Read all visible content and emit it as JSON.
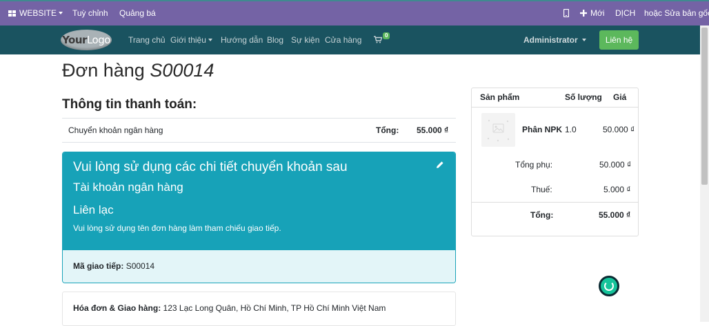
{
  "topbar": {
    "website_label": "WEBSITE",
    "customize_label": "Tuỳ chỉnh",
    "promote_label": "Quảng bá",
    "new_label": "Mới",
    "translate_label": "DỊCH",
    "edit_original_label": "hoặc Sửa bản gốc"
  },
  "navbar": {
    "logo_your": "Your",
    "logo_logo": "Logo",
    "items": [
      {
        "label": "Trang chủ"
      },
      {
        "label": "Giới thiệu"
      },
      {
        "label": "Hướng dẫn"
      },
      {
        "label": "Blog"
      },
      {
        "label": "Sự kiện"
      },
      {
        "label": "Cửa hàng"
      }
    ],
    "cart_count": "0",
    "user_label": "Administrator",
    "contact_label": "Liên hệ"
  },
  "page": {
    "title_prefix": "Đơn hàng",
    "order_ref": "S00014",
    "payment_title": "Thông tin thanh toán:",
    "payment_method": "Chuyển khoản ngân hàng",
    "total_label": "Tổng:",
    "total_value": "55.000 ₫"
  },
  "transfer": {
    "heading": "Vui lòng sử dụng các chi tiết chuyển khoản sau",
    "bank_account_label": "Tài khoản ngân hàng",
    "contact_heading": "Liên lạc",
    "contact_note": "Vui lòng sử dụng tên đơn hàng làm tham chiếu giao tiếp.",
    "comm_label": "Mã giao tiếp:",
    "comm_value": "S00014"
  },
  "address": {
    "label": "Hóa đơn & Giao hàng:",
    "value": "123 Lạc Long Quân, Hồ Chí Minh, TP Hồ Chí Minh Việt Nam"
  },
  "summary": {
    "col_product": "Sản phẩm",
    "col_qty": "Số lượng",
    "col_price": "Giá",
    "product_name": "Phân NPK",
    "product_qty": "1.0",
    "product_price": "50.000 ₫",
    "subtotal_label": "Tổng phụ:",
    "subtotal_value": "50.000 ₫",
    "tax_label": "Thuế:",
    "tax_value": "5.000 ₫",
    "total_label": "Tổng:",
    "total_value": "55.000 ₫"
  },
  "colors": {
    "topbar": "#7463a5",
    "navbar": "#1a5360",
    "alert": "#17a2b8",
    "success": "#5cb85c"
  },
  "icons": [
    "grid-icon",
    "mobile-icon",
    "plus-icon",
    "cart-icon",
    "pencil-icon",
    "product-image",
    "grammarly-icon"
  ]
}
